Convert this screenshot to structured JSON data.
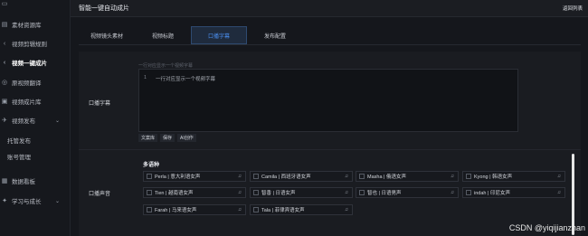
{
  "sidebar": {
    "items": [
      {
        "label": "",
        "icon": "folder-icon"
      },
      {
        "label": "素材资源库",
        "icon": "library-icon"
      },
      {
        "label": "视频剪辑规则",
        "icon": "chevron-left-icon"
      },
      {
        "label": "视频一键成片",
        "icon": "chevron-left-icon"
      },
      {
        "label": "原视频翻译",
        "icon": "translate-icon"
      },
      {
        "label": "视频成片库",
        "icon": "video-library-icon"
      },
      {
        "label": "视频发布",
        "icon": "publish-icon"
      },
      {
        "label": "托管发布",
        "icon": ""
      },
      {
        "label": "账号管理",
        "icon": ""
      },
      {
        "label": "数据看板",
        "icon": "dashboard-icon"
      },
      {
        "label": "学习与成长",
        "icon": "learn-icon"
      }
    ]
  },
  "header": {
    "title": "智能一键自动成片",
    "back_label": "返回列表"
  },
  "tabs": [
    {
      "label": "视频镜头素材"
    },
    {
      "label": "视频标题"
    },
    {
      "label": "口播字幕"
    },
    {
      "label": "发布配置"
    }
  ],
  "subtitle": {
    "row_label": "口播字幕",
    "hint": "一行对应显示一个视频字幕",
    "line_number": "1",
    "text": "一行对应显示一个视频字幕",
    "buttons": [
      "文案库",
      "保存",
      "AI创作"
    ]
  },
  "voice": {
    "row_label": "口播声音",
    "section_title": "多语种",
    "options": [
      {
        "name": "Perla | 意大利语女声"
      },
      {
        "name": "Camila | 西班牙语女声"
      },
      {
        "name": "Masha | 俄语女声"
      },
      {
        "name": "Kyong | 韩语女声"
      },
      {
        "name": "Tien | 越南语女声"
      },
      {
        "name": "智香 | 日语女声"
      },
      {
        "name": "智也 | 日语男声"
      },
      {
        "name": "indah | 印尼女声"
      },
      {
        "name": "Farah | 马来语女声"
      },
      {
        "name": "Tala | 菲律宾语女声"
      }
    ]
  },
  "watermark": "CSDN @yiqijianzhan",
  "colors": {
    "accent": "#4a8ff0",
    "background": "#15171c"
  }
}
